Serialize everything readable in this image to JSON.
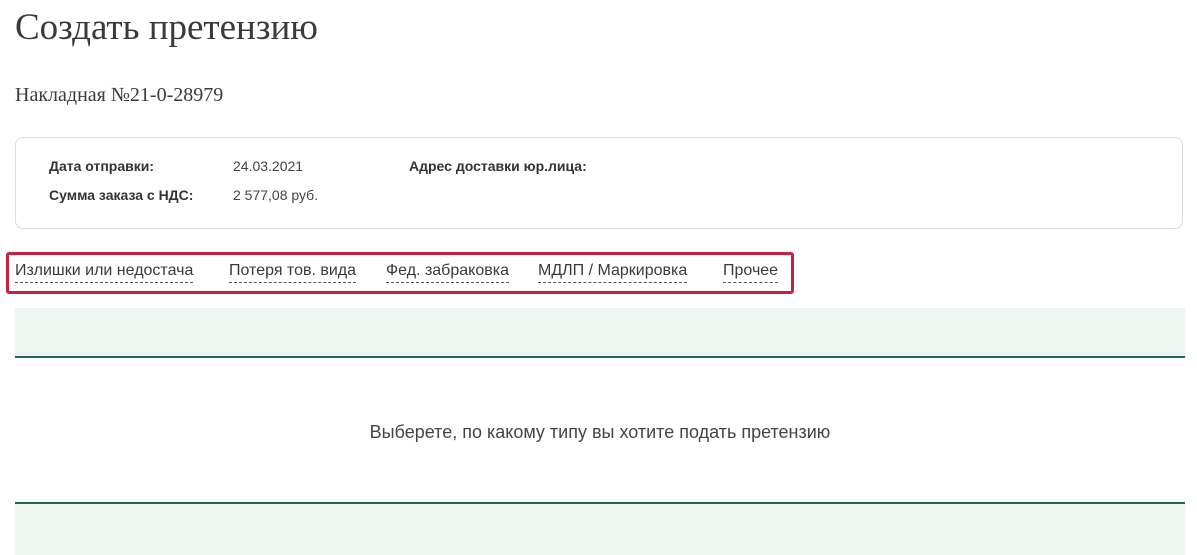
{
  "page": {
    "title": "Создать претензию",
    "invoice": "Накладная №21-0-28979"
  },
  "info": {
    "ship_date_label": "Дата отправки:",
    "ship_date_value": "24.03.2021",
    "order_sum_label": "Сумма заказа с НДС:",
    "order_sum_value": "2 577,08 руб.",
    "delivery_address_label": "Адрес доставки юр.лица:",
    "delivery_address_value": ""
  },
  "tabs": [
    {
      "label": "Излишки или недостача"
    },
    {
      "label": "Потеря тов. вида"
    },
    {
      "label": "Фед. забраковка"
    },
    {
      "label": "МДЛП / Маркировка"
    },
    {
      "label": "Прочее"
    }
  ],
  "content": {
    "hint": "Выберете, по какому типу вы хотите подать претензию"
  },
  "colors": {
    "highlight_border": "#c8203f",
    "accent_green": "#1f6a4a",
    "band_background": "#eef6f1"
  }
}
